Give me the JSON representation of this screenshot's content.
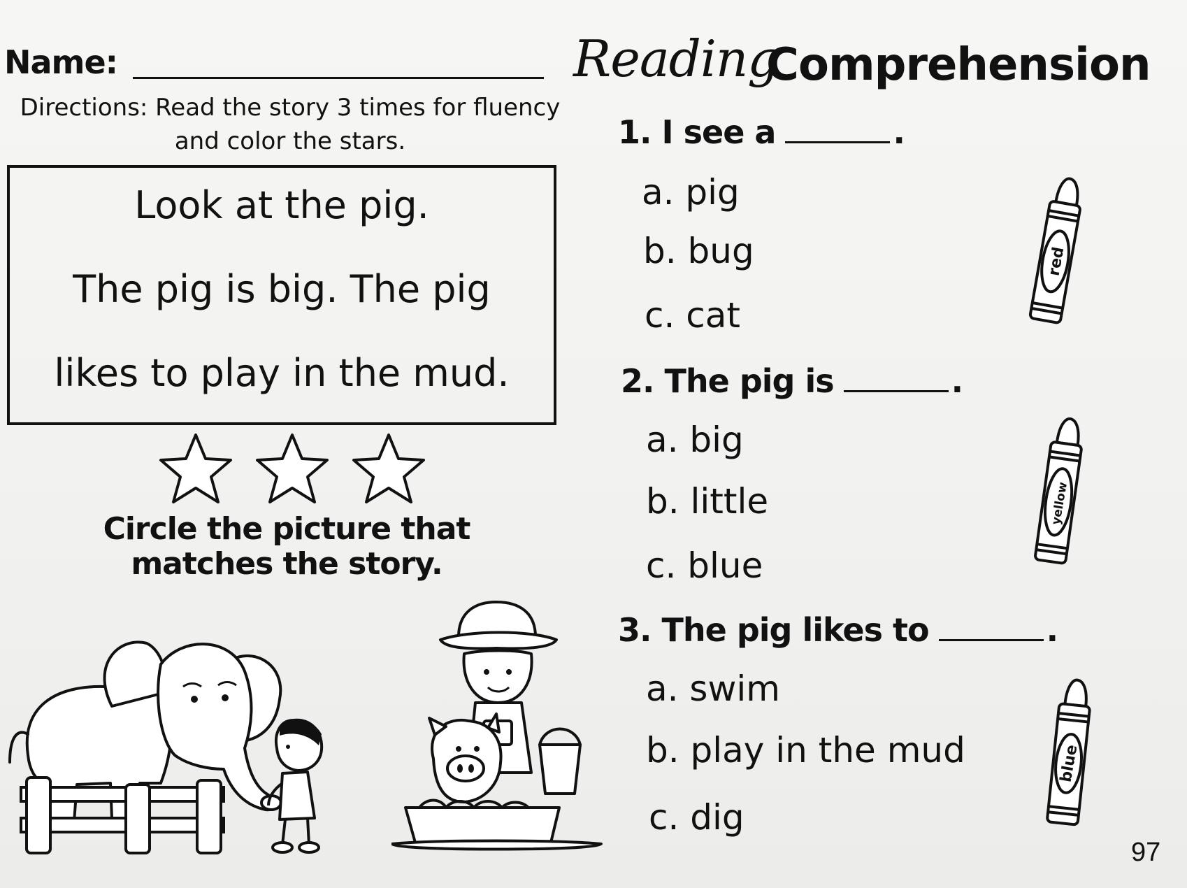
{
  "header": {
    "name_label": "Name:",
    "title_script": "Reading",
    "title_bold": "Comprehension"
  },
  "directions": {
    "line1": "Directions: Read the story 3 times for fluency",
    "line2": "and color the stars."
  },
  "story": {
    "line1": "Look at the pig.",
    "line2": "The pig is big. The pig",
    "line3": "likes to play in the mud."
  },
  "stars": {
    "count": 3
  },
  "circle_prompt": {
    "line1": "Circle the picture that",
    "line2": "matches the story."
  },
  "questions": [
    {
      "prompt": "1. I see a",
      "end": ".",
      "options": [
        "a. pig",
        "b. bug",
        "c. cat"
      ],
      "crayon_label": "red"
    },
    {
      "prompt": "2. The pig is",
      "end": ".",
      "options": [
        "a. big",
        "b. little",
        "c. blue"
      ],
      "crayon_label": "yellow"
    },
    {
      "prompt": "3. The pig likes to",
      "end": ".",
      "options": [
        "a. swim",
        "b. play in the mud",
        "c. dig"
      ],
      "crayon_label": "blue"
    }
  ],
  "page_number": "97",
  "icons": {
    "star": "star-outline-icon",
    "crayon": "crayon-icon",
    "picture_left": "elephant-girl-illustration",
    "picture_right": "farmer-pig-illustration"
  }
}
